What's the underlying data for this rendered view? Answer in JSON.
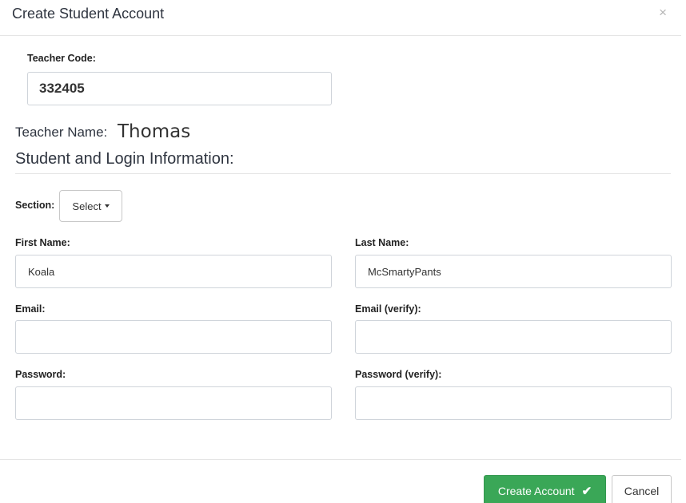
{
  "modal": {
    "title": "Create Student Account",
    "close_icon": "close-icon",
    "close_glyph": "×"
  },
  "teacher_code": {
    "label": "Teacher Code:",
    "value": "332405"
  },
  "teacher_name": {
    "label": "Teacher Name:",
    "value": "Thomas"
  },
  "section_heading": "Student and Login Information:",
  "section_select": {
    "label": "Section:",
    "selected": "Select"
  },
  "fields": {
    "first_name": {
      "label": "First Name:",
      "value": "Koala"
    },
    "last_name": {
      "label": "Last Name:",
      "value": "McSmartyPants"
    },
    "email": {
      "label": "Email:",
      "value": ""
    },
    "email_verify": {
      "label": "Email (verify):",
      "value": ""
    },
    "password": {
      "label": "Password:",
      "value": ""
    },
    "password_verify": {
      "label": "Password (verify):",
      "value": ""
    }
  },
  "footer": {
    "create_label": "Create Account",
    "create_icon": "checkmark-icon",
    "check_glyph": "✔",
    "cancel_label": "Cancel",
    "create_color": "#3aa757"
  }
}
